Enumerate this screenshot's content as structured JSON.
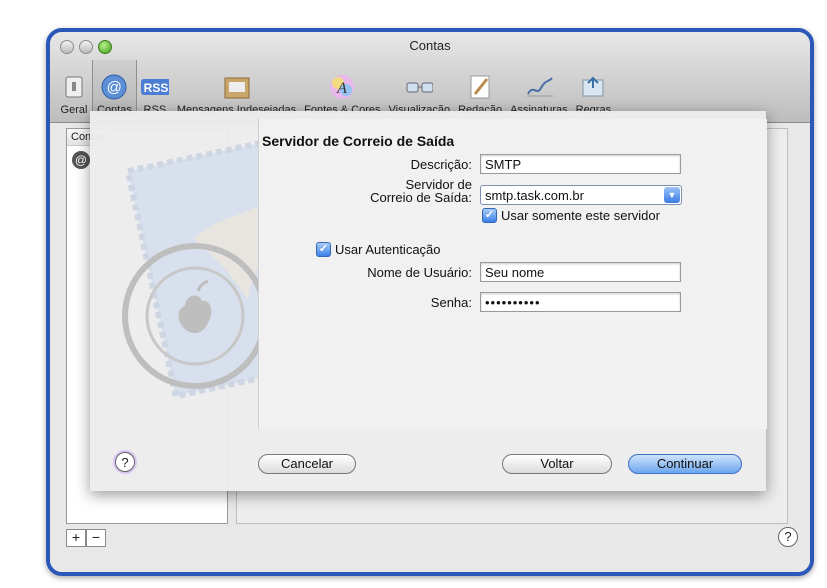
{
  "window": {
    "title": "Contas"
  },
  "toolbar": {
    "items": [
      {
        "label": "Geral",
        "icon": "switch-icon"
      },
      {
        "label": "Contas",
        "icon": "at-sign-icon",
        "selected": true
      },
      {
        "label": "RSS",
        "icon": "rss-icon"
      },
      {
        "label": "Mensagens Indesejadas",
        "icon": "junk-mail-icon"
      },
      {
        "label": "Fontes & Cores",
        "icon": "fonts-colors-icon"
      },
      {
        "label": "Visualização",
        "icon": "glasses-icon"
      },
      {
        "label": "Redação",
        "icon": "pencil-icon"
      },
      {
        "label": "Assinaturas",
        "icon": "signature-icon"
      },
      {
        "label": "Regras",
        "icon": "rules-icon"
      }
    ]
  },
  "accounts": {
    "header": "Contas"
  },
  "sheet": {
    "heading": "Servidor de Correio de Saída",
    "description_label": "Descrição:",
    "description_value": "SMTP",
    "server_label_line1": "Servidor de",
    "server_label_line2": "Correio de Saída:",
    "server_value": "smtp.task.com.br",
    "only_server_label": "Usar somente este servidor",
    "auth_label": "Usar Autenticação",
    "username_label": "Nome de Usuário:",
    "username_value": "Seu nome",
    "password_label": "Senha:",
    "password_value": "••••••••••",
    "cancel": "Cancelar",
    "back": "Voltar",
    "continue": "Continuar",
    "help": "?"
  },
  "bottom": {
    "add": "+",
    "remove": "−",
    "help": "?"
  },
  "colors": {
    "frame": "#2a57b8",
    "accent": "#3b80e8"
  }
}
